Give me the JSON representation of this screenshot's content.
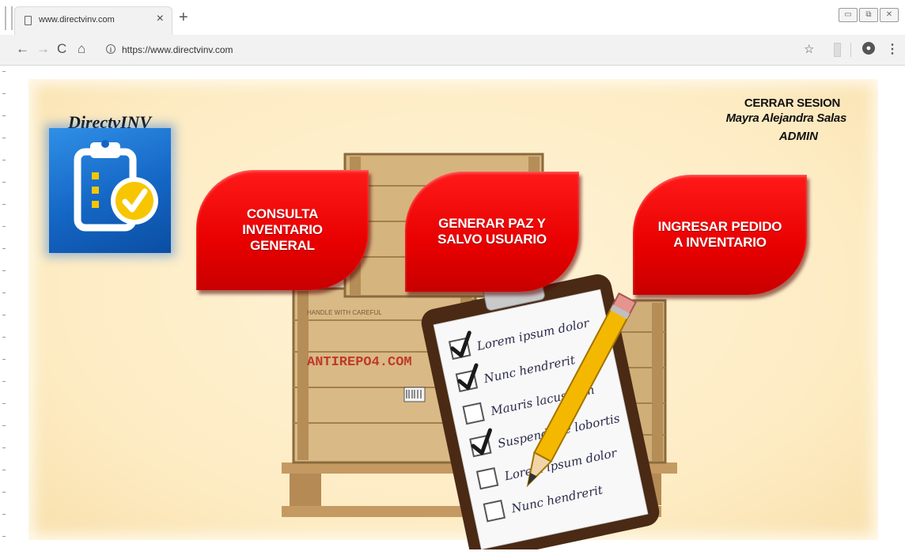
{
  "browser": {
    "tab_title": "www.directvinv.com",
    "tab_close": "×",
    "new_tab": "+",
    "url": "https://www.directvinv.com",
    "window_controls": [
      "▭",
      "⧉",
      "✕"
    ]
  },
  "app": {
    "brand_name": "DirectvINV",
    "user": {
      "logout_label": "CERRAR SESION",
      "name": "Mayra Alejandra Salas",
      "role": "ADMIN"
    },
    "actions": [
      {
        "label": "CONSULTA\nINVENTARIO\nGENERAL"
      },
      {
        "label": "GENERAR PAZ Y\nSALVO USUARIO"
      },
      {
        "label": "INGRESAR PEDIDO\nA INVENTARIO"
      }
    ],
    "illustration": {
      "crate_text": "ANTIREPO4.COM",
      "crate_small": "HANDLE WITH CAREFUL",
      "checklist": [
        "Lorem ipsum dolor",
        "Nunc hendrerit",
        "Mauris lacus sem",
        "Suspendisse lobortis",
        "Lorem ipsum dolor",
        "Nunc hendrerit"
      ],
      "checked": [
        true,
        true,
        false,
        true,
        false,
        false
      ]
    }
  },
  "colors": {
    "button_red": "#e80000",
    "page_bg": "#fdebc2",
    "logo_blue": "#1466c4",
    "check_yellow": "#f5b800"
  }
}
